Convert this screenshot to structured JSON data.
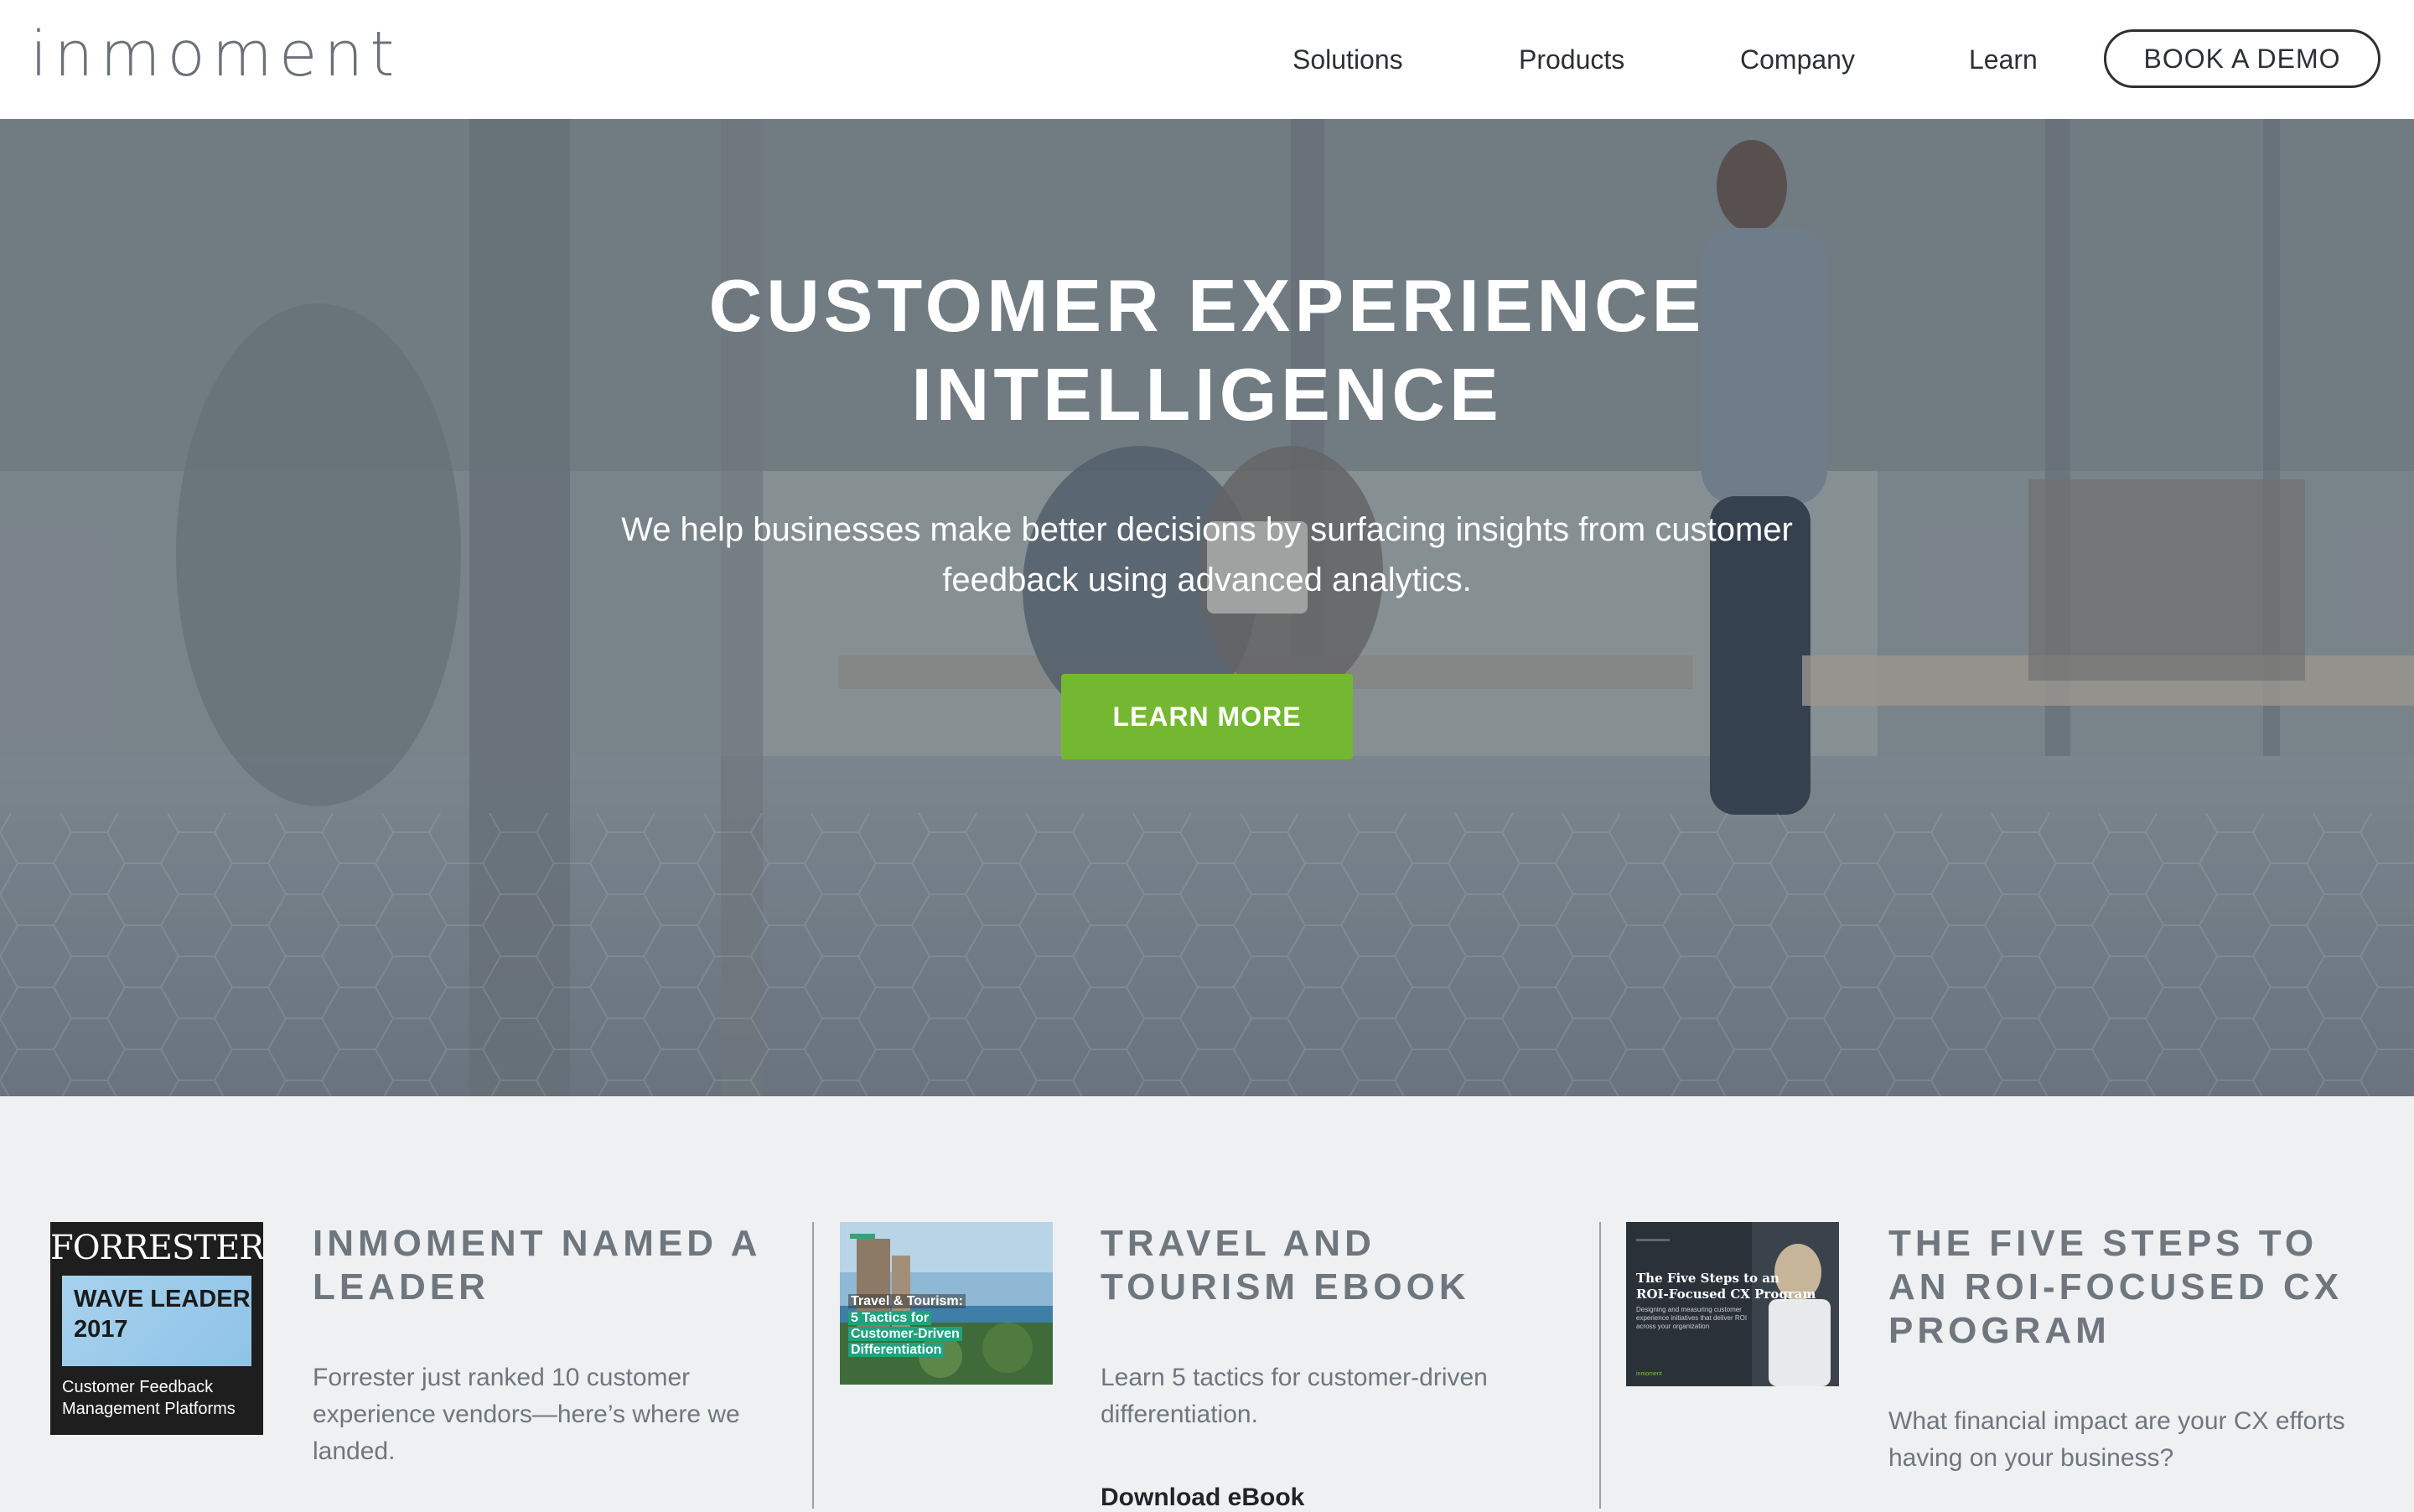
{
  "header": {
    "logo": "inmoment",
    "nav": [
      "Solutions",
      "Products",
      "Company",
      "Learn"
    ],
    "cta": "BOOK A DEMO"
  },
  "hero": {
    "title_line1": "CUSTOMER EXPERIENCE",
    "title_line2": "INTELLIGENCE",
    "subtitle": "We help businesses make better decisions by surfacing insights from customer feedback using advanced analytics.",
    "button": "LEARN MORE"
  },
  "cards": [
    {
      "title": "INMOMENT NAMED A LEADER",
      "text": "Forrester just ranked 10 customer experience vendors—here’s where we landed.",
      "thumb": {
        "brand": "FORRESTER",
        "reg": "®",
        "band_line1": "WAVE LEADER",
        "band_line2": "2017",
        "tag_line1": "Customer Feedback",
        "tag_line2": "Management Platforms"
      }
    },
    {
      "title": "TRAVEL AND TOURISM EBOOK",
      "text": "Learn 5 tactics for customer-driven differentiation.",
      "link": "Download eBook",
      "thumb": {
        "line1": "Travel & Tourism:",
        "line2": "5 Tactics for",
        "line3": "Customer-Driven",
        "line4": "Differentiation"
      }
    },
    {
      "title": "THE FIVE STEPS TO AN ROI-FOCUSED CX PROGRAM",
      "text": "What financial impact are your CX efforts having on your business?",
      "thumb": {
        "line1": "The Five Steps to an",
        "line2": "ROI-Focused CX Program",
        "desc": "Designing and measuring customer experience initiatives that deliver ROI across your organization",
        "brand": "inmoment"
      }
    }
  ],
  "colors": {
    "accent_green": "#74b832",
    "text_dark": "#2b3036",
    "card_text": "#6e767e",
    "section_bg": "#eff0f2"
  }
}
